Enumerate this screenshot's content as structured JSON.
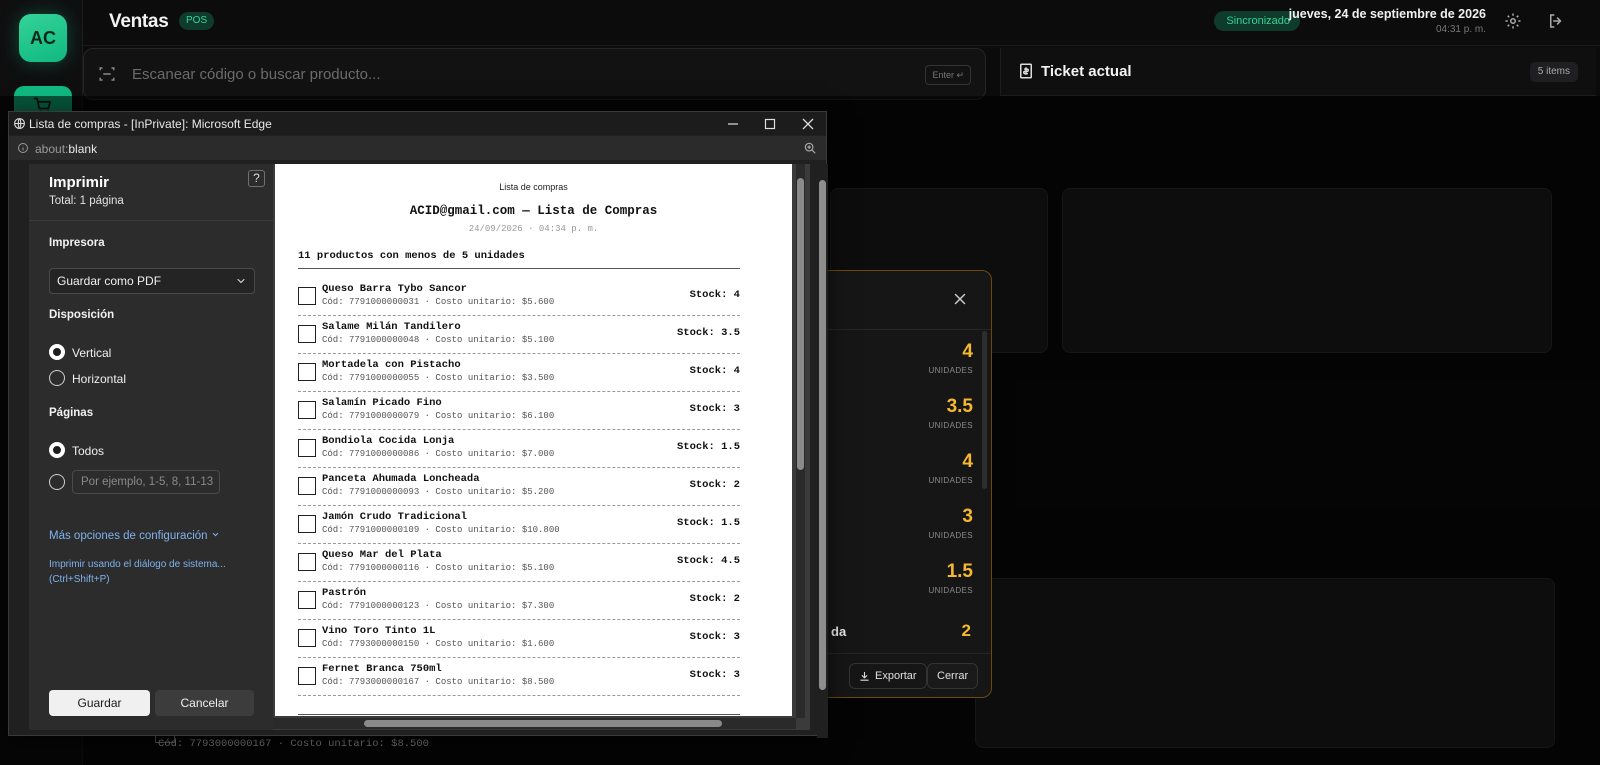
{
  "app": {
    "logo_text": "AC",
    "title": "Ventas",
    "pos_badge": "POS",
    "sync_status": "Sincronizado",
    "date": "jueves, 24 de septiembre de 2026",
    "time": "04:31 p. m.",
    "search_placeholder": "Escanear código o buscar producto...",
    "enter_hint": "Enter ↵",
    "ticket_title": "Ticket actual",
    "ticket_count": "5 items",
    "accent_color": "#10b981"
  },
  "stock_modal": {
    "rows": [
      {
        "value": "4",
        "unit": "UNIDADES"
      },
      {
        "value": "3.5",
        "unit": "UNIDADES"
      },
      {
        "value": "4",
        "unit": "UNIDADES"
      },
      {
        "value": "3",
        "unit": "UNIDADES"
      },
      {
        "value": "1.5",
        "unit": "UNIDADES"
      }
    ],
    "partial_label": "da",
    "partial_value": "2",
    "export_label": "Exportar",
    "close_label": "Cerrar",
    "value_color": "#f5b82e"
  },
  "behind_row": {
    "code": "Cód: 7793000000167 · Costo unitario: $8.500"
  },
  "browser": {
    "title": "Lista de compras - [InPrivate]: Microsoft Edge",
    "address_prefix": "about:",
    "address_main": "blank"
  },
  "print": {
    "title": "Imprimir",
    "total": "Total: 1 página",
    "help": "?",
    "printer_label": "Impresora",
    "printer_value": "Guardar como PDF",
    "layout_label": "Disposición",
    "layout_options": [
      "Vertical",
      "Horizontal"
    ],
    "layout_selected": "Vertical",
    "pages_label": "Páginas",
    "pages_all": "Todos",
    "pages_placeholder": "Por ejemplo, 1-5, 8, 11-13",
    "more_options": "Más opciones de configuración",
    "system_dialog_line1": "Imprimir usando el diálogo de sistema...",
    "system_dialog_line2": "(Ctrl+Shift+P)",
    "save_label": "Guardar",
    "cancel_label": "Cancelar"
  },
  "preview": {
    "header": "Lista de compras",
    "title": "ACID@gmail.com — Lista de Compras",
    "date": "24/09/2026 · 04:34 p. m.",
    "count": "11 productos con menos de 5 unidades",
    "items": [
      {
        "name": "Queso Barra Tybo Sancor",
        "code": "Cód: 7791000000031 · Costo unitario: $5.600",
        "stock": "Stock: 4"
      },
      {
        "name": "Salame Milán Tandilero",
        "code": "Cód: 7791000000048 · Costo unitario: $5.100",
        "stock": "Stock: 3.5"
      },
      {
        "name": "Mortadela con Pistacho",
        "code": "Cód: 7791000000055 · Costo unitario: $3.500",
        "stock": "Stock: 4"
      },
      {
        "name": "Salamín Picado Fino",
        "code": "Cód: 7791000000079 · Costo unitario: $6.100",
        "stock": "Stock: 3"
      },
      {
        "name": "Bondiola Cocida Lonja",
        "code": "Cód: 7791000000086 · Costo unitario: $7.000",
        "stock": "Stock: 1.5"
      },
      {
        "name": "Panceta Ahumada Loncheada",
        "code": "Cód: 7791000000093 · Costo unitario: $5.200",
        "stock": "Stock: 2"
      },
      {
        "name": "Jamón Crudo Tradicional",
        "code": "Cód: 7791000000109 · Costo unitario: $10.800",
        "stock": "Stock: 1.5"
      },
      {
        "name": "Queso Mar del Plata",
        "code": "Cód: 7791000000116 · Costo unitario: $5.100",
        "stock": "Stock: 4.5"
      },
      {
        "name": "Pastrón",
        "code": "Cód: 7791000000123 · Costo unitario: $7.300",
        "stock": "Stock: 2"
      },
      {
        "name": "Vino Toro Tinto 1L",
        "code": "Cód: 7793000000150 · Costo unitario: $1.600",
        "stock": "Stock: 3"
      },
      {
        "name": "Fernet Branca 750ml",
        "code": "Cód: 7793000000167 · Costo unitario: $8.500",
        "stock": "Stock: 3"
      }
    ]
  }
}
